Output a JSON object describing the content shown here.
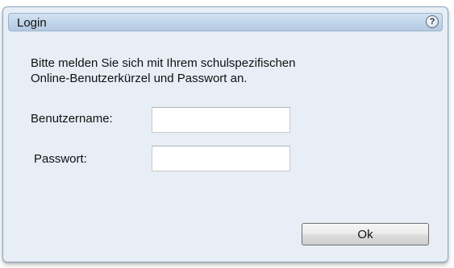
{
  "dialog": {
    "title": "Login",
    "help_symbol": "?",
    "help_icon": "question-mark-icon",
    "message_line1": "Bitte melden Sie sich mit Ihrem schulspezifischen",
    "message_line2": "Online-Benutzerkürzel und Passwort an.",
    "username_label": "Benutzername:",
    "username_value": "",
    "password_label": "Passwort:",
    "password_value": "",
    "ok_label": "Ok"
  },
  "colors": {
    "dialog_background": "#e7eef6",
    "titlebar_gradient_top": "#d3e2f1",
    "titlebar_gradient_bottom": "#b5cbe2",
    "border": "#8fa9c3"
  }
}
